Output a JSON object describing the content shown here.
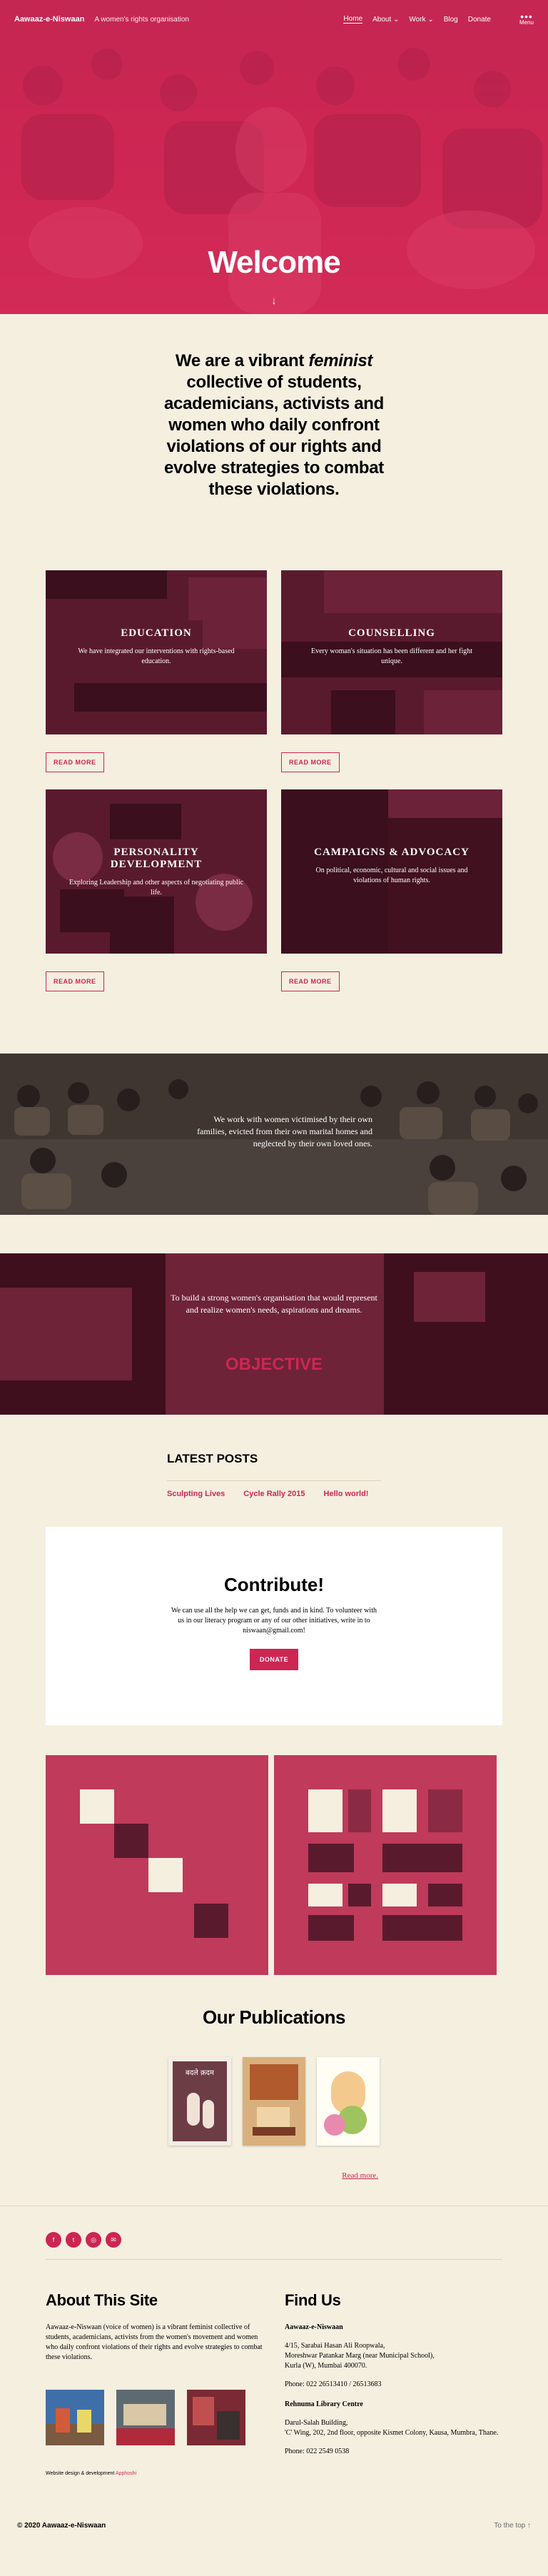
{
  "header": {
    "site_title": "Aawaaz-e-Niswaan",
    "tagline": "A women's rights organisation",
    "nav": [
      "Home",
      "About ⌄",
      "Work ⌄",
      "Blog",
      "Donate"
    ],
    "menu_label": "Menu"
  },
  "hero": {
    "title": "Welcome",
    "arrow": "↓"
  },
  "intro": {
    "pre": "We are a vibrant ",
    "em": "feminist",
    "post": " collective of students, academicians, activists and women who daily confront violations of our rights and evolve strategies to combat these violations."
  },
  "services": [
    {
      "title": "EDUCATION",
      "text": "We have integrated our interventions with rights-based education.",
      "button": "READ MORE"
    },
    {
      "title": "COUNSELLING",
      "text": "Every woman's situation has been different and her fight unique.",
      "button": "READ MORE"
    },
    {
      "title": "PERSONALITY DEVELOPMENT",
      "text": "Exploring Leadership and other aspects of negotiating public life.",
      "button": "READ MORE"
    },
    {
      "title": "CAMPAIGNS & ADVOCACY",
      "text": "On political, economic, cultural and social issues and violations of human rights.",
      "button": "READ MORE"
    }
  ],
  "work": {
    "text": "We work with women victimised by their own families, evicted from their own marital homes and neglected by their own loved ones."
  },
  "objective": {
    "text": "To build a strong women's organisation that would represent and realize women's needs, aspirations and dreams.",
    "title": "OBJECTIVE"
  },
  "latest": {
    "title": "LATEST POSTS",
    "posts": [
      "Sculpting Lives",
      "Cycle Rally 2015",
      "Hello world!"
    ]
  },
  "contribute": {
    "title": "Contribute!",
    "text": "We can use all the help we can get, funds and in kind. To volunteer with us in our literacy program or any of our other initiatives, write in to niswaan@gmail.com!",
    "button": "DONATE"
  },
  "publications": {
    "title": "Our Publications",
    "read_more": "Read more.",
    "book1_title": "बदले क़दम"
  },
  "footer": {
    "social_icons": [
      "facebook-icon",
      "twitter-icon",
      "instagram-icon",
      "email-icon"
    ],
    "about_title": "About This Site",
    "about_text": "Aawaaz-e-Niswaan (voice of women) is a vibrant feminist collective of students, academicians, activists from the women's movement and women who daily confront violations of their rights and evolve strategies to combat these violations.",
    "credit_pre": "Website design & development",
    "credit_link": "Apphoshi",
    "find_title": "Find Us",
    "org1": "Aawaaz-e-Niswaan",
    "addr1": "4/15, Sarabai Hasan Ali Roopwala,",
    "addr2": "Moreshwar Patankar Marg (near Municipal School),",
    "addr3": "Kurla (W), Mumbai 400070.",
    "phone1": "Phone: 022 26513410 / 26513683",
    "org2": "Rehnuma Library Centre",
    "addr4": "Darul-Salah Building,",
    "addr5": "'C' Wing, 202, 2nd floor, opposite Kismet Colony, Kausa, Mumbra, Thane.",
    "phone2": "Phone: 022 2549 0538",
    "copyright": "© 2020 Aawaaz-e-Niswaan",
    "to_top": "To the top ↑"
  },
  "colors": {
    "accent": "#cd2653",
    "background": "#f5efe0",
    "card": "#5a1a2e"
  }
}
